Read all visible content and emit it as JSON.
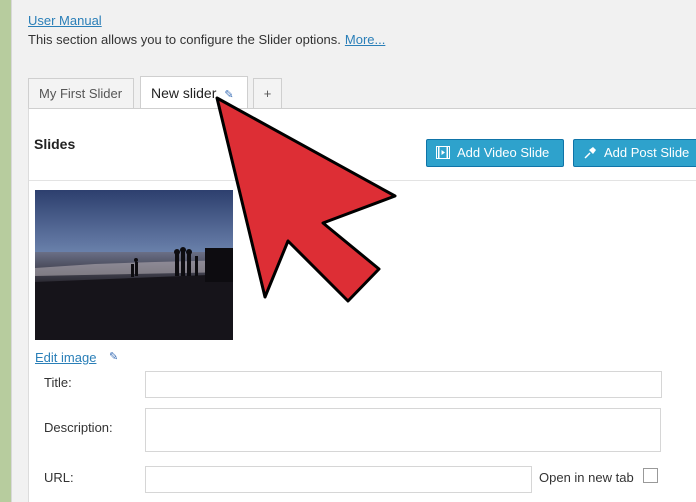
{
  "header": {
    "manual_link": "User Manual",
    "description": "This section allows you to configure the Slider options.",
    "more_link": "More..."
  },
  "tabs": [
    {
      "label": "My First Slider",
      "active": false
    },
    {
      "label": "New slider",
      "active": true
    },
    {
      "label": "+",
      "active": false
    }
  ],
  "slides": {
    "title": "Slides",
    "add_video_label": "Add Video Slide",
    "add_post_label": "Add Post Slide",
    "edit_image_link": "Edit image"
  },
  "form": {
    "title_label": "Title:",
    "title_value": "",
    "description_label": "Description:",
    "description_value": "",
    "url_label": "URL:",
    "url_value": "",
    "open_new_tab_label": "Open in new tab",
    "open_new_tab_checked": false
  },
  "colors": {
    "background_green": "#b7cc9e",
    "button_blue": "#2ea2cc",
    "link_blue": "#2a7fb8",
    "arrow_red": "#dd2e35"
  },
  "icons": {
    "pencil": "pencil-icon",
    "video": "film-icon",
    "post": "pin-icon",
    "arrow": "red-arrow-pointer"
  }
}
